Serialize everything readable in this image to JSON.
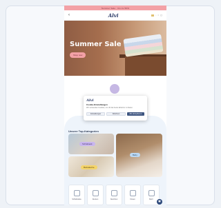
{
  "promo_bar": {
    "text": "Sommer Sale · bis zu 50%"
  },
  "navbar": {
    "logo": "Alvi"
  },
  "hero": {
    "title": "Summer Sale",
    "button_label": "Shop now"
  },
  "cookie_banner": {
    "logo": "Alvi",
    "title": "Cookie-Einstellungen",
    "text": "Wir verwenden Cookies, um dir das beste Erlebnis zu bieten.",
    "buttons": [
      "Einstellungen",
      "Ablehnen",
      "Alle akzeptieren"
    ]
  },
  "section": {
    "title": "Unsere Top-Kategorien"
  },
  "tiles": [
    {
      "label": "Schlafsack"
    },
    {
      "label": "Bettwäsche"
    },
    {
      "label": "Baby"
    }
  ],
  "categories": [
    {
      "label": "Schlafsäcke"
    },
    {
      "label": "Decken"
    },
    {
      "label": "Nestchen"
    },
    {
      "label": "Kissen"
    },
    {
      "label": "Mehr"
    }
  ],
  "colors": {
    "accent_pink": "#f3a1a6",
    "brand_navy": "#2b3a67",
    "button_dark": "#3e5580"
  }
}
